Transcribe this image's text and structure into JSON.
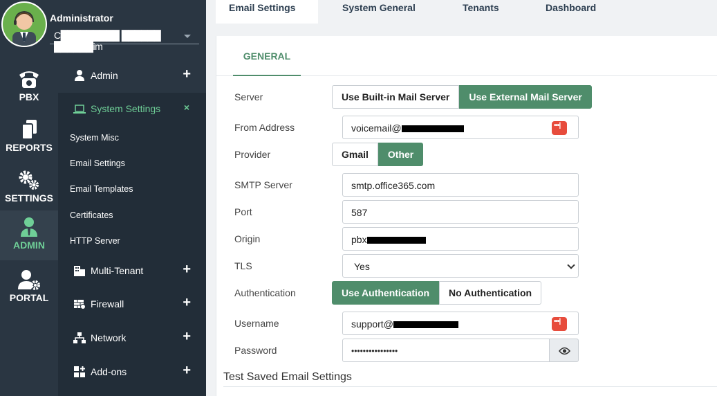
{
  "user": {
    "name": "Administrator",
    "account": "C█████████ ██████ ██████im"
  },
  "rail": [
    {
      "label": "PBX",
      "icon": "phone-icon"
    },
    {
      "label": "REPORTS",
      "icon": "documents-icon"
    },
    {
      "label": "SETTINGS",
      "icon": "gears-icon"
    },
    {
      "label": "ADMIN",
      "icon": "admin-user-icon",
      "active": true
    },
    {
      "label": "PORTAL",
      "icon": "user-gear-icon"
    }
  ],
  "menu": {
    "admin": "Admin",
    "system_settings": "System Settings",
    "sub_items": [
      "System Misc",
      "Email Settings",
      "Email Templates",
      "Certificates",
      "HTTP Server"
    ],
    "multi_tenant": "Multi-Tenant",
    "firewall": "Firewall",
    "network": "Network",
    "addons": "Add-ons",
    "plus": "+",
    "close": "×"
  },
  "tabs": [
    "Email Settings",
    "System General",
    "Tenants",
    "Dashboard"
  ],
  "card": {
    "section_tab": "GENERAL",
    "server": {
      "label": "Server",
      "options": [
        "Use Built-in Mail Server",
        "Use External Mail Server"
      ],
      "selected": "Use External Mail Server"
    },
    "from_address": {
      "label": "From Address",
      "value": "voicemail@"
    },
    "provider": {
      "label": "Provider",
      "options": [
        "Gmail",
        "Other"
      ],
      "selected": "Other"
    },
    "smtp_server": {
      "label": "SMTP Server",
      "value": "smtp.office365.com"
    },
    "port": {
      "label": "Port",
      "value": "587"
    },
    "origin": {
      "label": "Origin",
      "value": "pbx"
    },
    "tls": {
      "label": "TLS",
      "value": "Yes"
    },
    "authentication": {
      "label": "Authentication",
      "options": [
        "Use Authentication",
        "No Authentication"
      ],
      "selected": "Use Authentication"
    },
    "username": {
      "label": "Username",
      "value": "support@"
    },
    "password": {
      "label": "Password",
      "value": "••••••••••••••••"
    },
    "test_title": "Test Saved Email Settings"
  },
  "colors": {
    "accent": "#4f8d6b",
    "rail_bg": "#2a3642",
    "sidebar_bg": "#222d38",
    "menu_active": "#6fcf97"
  }
}
